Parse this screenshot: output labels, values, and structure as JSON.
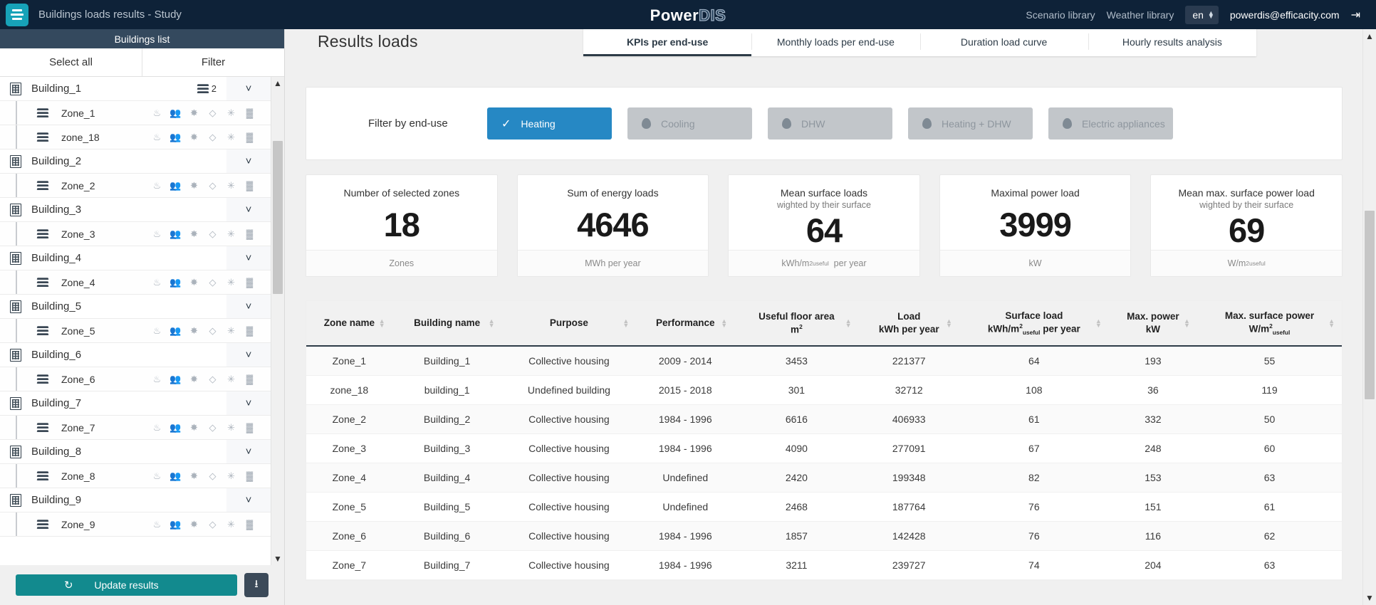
{
  "topbar": {
    "menu_icon": "list-icon",
    "app_title": "Buildings loads results - Study",
    "brand_1": "Power",
    "brand_2": "DIS",
    "scenario_library": "Scenario library",
    "weather_library": "Weather library",
    "language": "en",
    "user_email": "powerdis@efficacity.com",
    "logout_icon": "logout-icon"
  },
  "sidebar": {
    "header": "Buildings list",
    "select_all": "Select all",
    "filter": "Filter",
    "update_button": "Update results",
    "refresh_icon": "refresh-icon",
    "download_icon": "download-icon",
    "zone_icon_names": [
      "heating-icon",
      "occupancy-icon",
      "ventilation-icon",
      "dhw-droplet-icon",
      "cooling-snowflake-icon",
      "electric-heating-icon"
    ],
    "buildings": [
      {
        "name": "Building_1",
        "count": "2",
        "zones": [
          {
            "name": "Zone_1"
          },
          {
            "name": "zone_18"
          }
        ]
      },
      {
        "name": "Building_2",
        "count": "",
        "zones": [
          {
            "name": "Zone_2"
          }
        ]
      },
      {
        "name": "Building_3",
        "count": "",
        "zones": [
          {
            "name": "Zone_3"
          }
        ]
      },
      {
        "name": "Building_4",
        "count": "",
        "zones": [
          {
            "name": "Zone_4"
          }
        ]
      },
      {
        "name": "Building_5",
        "count": "",
        "zones": [
          {
            "name": "Zone_5"
          }
        ]
      },
      {
        "name": "Building_6",
        "count": "",
        "zones": [
          {
            "name": "Zone_6"
          }
        ]
      },
      {
        "name": "Building_7",
        "count": "",
        "zones": [
          {
            "name": "Zone_7"
          }
        ]
      },
      {
        "name": "Building_8",
        "count": "",
        "zones": [
          {
            "name": "Zone_8"
          }
        ]
      },
      {
        "name": "Building_9",
        "count": "",
        "zones": [
          {
            "name": "Zone_9"
          }
        ]
      }
    ]
  },
  "main": {
    "page_title": "Results loads",
    "tabs": [
      {
        "label": "KPIs per end-use",
        "active": true
      },
      {
        "label": "Monthly loads per end-use",
        "active": false
      },
      {
        "label": "Duration load curve",
        "active": false
      },
      {
        "label": "Hourly results analysis",
        "active": false
      }
    ],
    "filter": {
      "label": "Filter by end-use",
      "options": [
        {
          "label": "Heating",
          "selected": true
        },
        {
          "label": "Cooling",
          "selected": false
        },
        {
          "label": "DHW",
          "selected": false
        },
        {
          "label": "Heating + DHW",
          "selected": false
        },
        {
          "label": "Electric appliances",
          "selected": false
        }
      ]
    },
    "kpis": [
      {
        "title": "Number of selected zones",
        "subtitle": "",
        "value": "18",
        "unit_html": "Zones"
      },
      {
        "title": "Sum of energy loads",
        "subtitle": "",
        "value": "4646",
        "unit_html": "MWh per year"
      },
      {
        "title": "Mean surface loads",
        "subtitle": "wighted by their surface",
        "value": "64",
        "unit_html": "kWh/m<sup>2</sup><sub>useful</sub>&nbsp; per year"
      },
      {
        "title": "Maximal power load",
        "subtitle": "",
        "value": "3999",
        "unit_html": "kW"
      },
      {
        "title": "Mean max. surface power load",
        "subtitle": "wighted by their surface",
        "value": "69",
        "unit_html": "W/m<sup>2</sup><sub>useful</sub>"
      }
    ]
  },
  "table": {
    "columns": [
      {
        "line1": "Zone name",
        "line2": ""
      },
      {
        "line1": "Building name",
        "line2": ""
      },
      {
        "line1": "Purpose",
        "line2": ""
      },
      {
        "line1": "Performance",
        "line2": ""
      },
      {
        "line1": "Useful floor area",
        "line2_html": "m<sup>2</sup>"
      },
      {
        "line1": "Load",
        "line2_html": "kWh per year"
      },
      {
        "line1": "Surface load",
        "line2_html": "kWh/m<sup>2</sup><sub>useful</sub> per year"
      },
      {
        "line1": "Max. power",
        "line2_html": "kW"
      },
      {
        "line1": "Max. surface power",
        "line2_html": "W/m<sup>2</sup><sub>useful</sub>"
      }
    ],
    "rows": [
      [
        "Zone_1",
        "Building_1",
        "Collective housing",
        "2009 - 2014",
        "3453",
        "221377",
        "64",
        "193",
        "55"
      ],
      [
        "zone_18",
        "building_1",
        "Undefined building",
        "2015 - 2018",
        "301",
        "32712",
        "108",
        "36",
        "119"
      ],
      [
        "Zone_2",
        "Building_2",
        "Collective housing",
        "1984 - 1996",
        "6616",
        "406933",
        "61",
        "332",
        "50"
      ],
      [
        "Zone_3",
        "Building_3",
        "Collective housing",
        "1984 - 1996",
        "4090",
        "277091",
        "67",
        "248",
        "60"
      ],
      [
        "Zone_4",
        "Building_4",
        "Collective housing",
        "Undefined",
        "2420",
        "199348",
        "82",
        "153",
        "63"
      ],
      [
        "Zone_5",
        "Building_5",
        "Collective housing",
        "Undefined",
        "2468",
        "187764",
        "76",
        "151",
        "61"
      ],
      [
        "Zone_6",
        "Building_6",
        "Collective housing",
        "1984 - 1996",
        "1857",
        "142428",
        "76",
        "116",
        "62"
      ],
      [
        "Zone_7",
        "Building_7",
        "Collective housing",
        "1984 - 1996",
        "3211",
        "239727",
        "74",
        "204",
        "63"
      ]
    ]
  },
  "colors": {
    "topbar": "#0e2238",
    "accent_teal": "#17a2b8",
    "selected_blue": "#2688c4",
    "update_green": "#128a8e",
    "sidebar_header": "#34495e"
  }
}
